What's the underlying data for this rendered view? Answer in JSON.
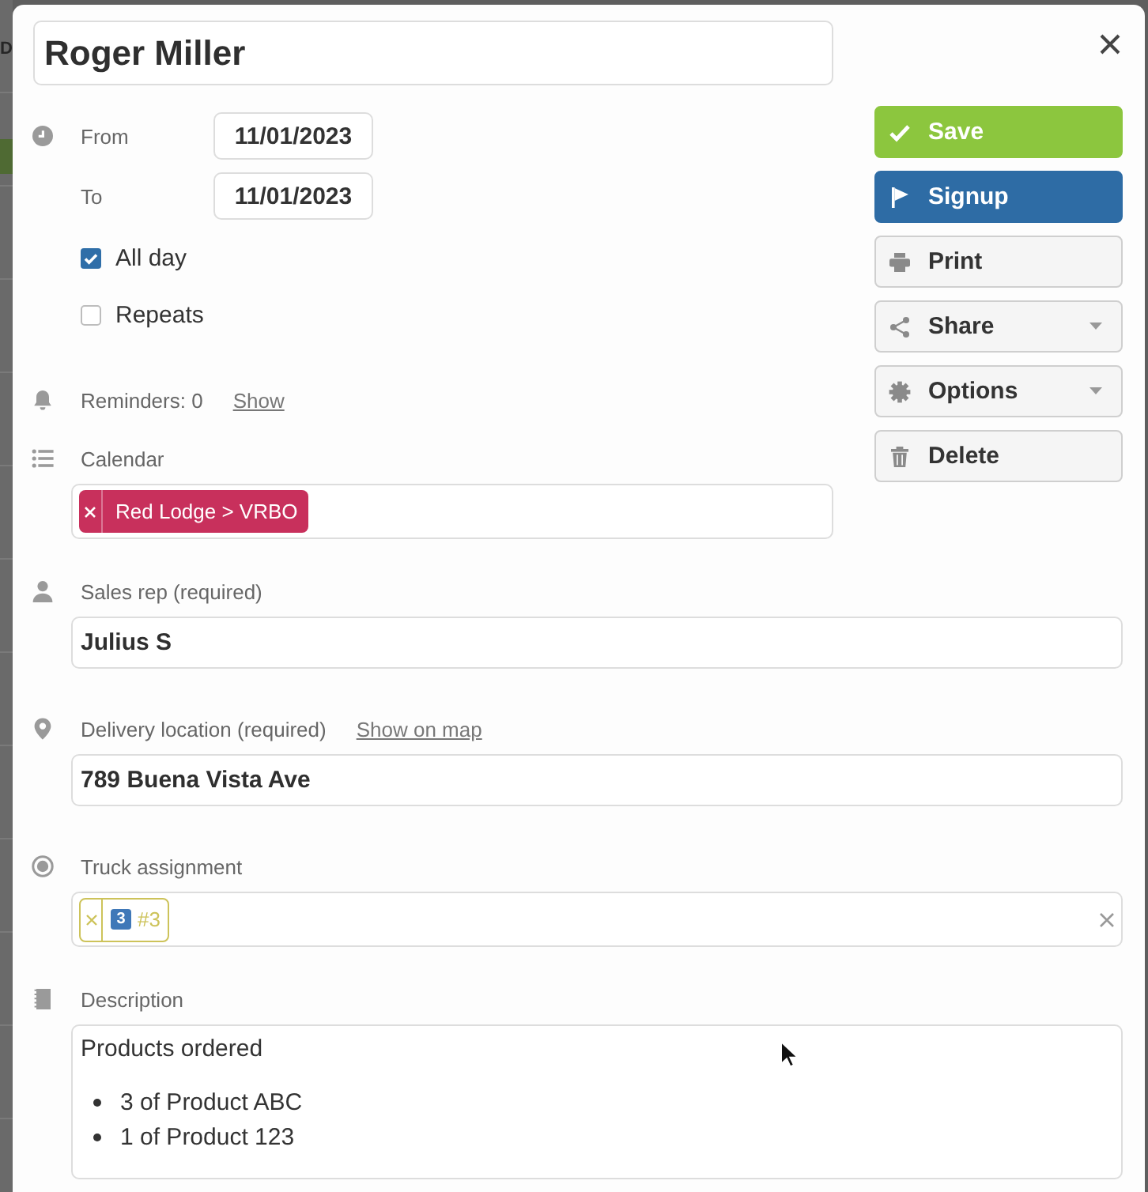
{
  "backdrop": {
    "text": "D"
  },
  "title": {
    "value": "Roger Miller"
  },
  "dates": [
    {
      "label": "From",
      "value": "11/01/2023"
    },
    {
      "label": "To",
      "value": "11/01/2023"
    }
  ],
  "options": [
    {
      "label": "All day",
      "checked": true
    },
    {
      "label": "Repeats",
      "checked": false
    }
  ],
  "reminders": {
    "text": "Reminders: 0",
    "link": "Show"
  },
  "calendar": {
    "label": "Calendar",
    "tags": [
      {
        "text": "Red Lodge > VRBO",
        "color": "#c8305c"
      }
    ]
  },
  "actions": [
    {
      "label": "Save",
      "kind": "success",
      "menu": false
    },
    {
      "label": "Signup",
      "kind": "primary",
      "menu": false
    },
    {
      "label": "Print",
      "kind": "default",
      "menu": false
    },
    {
      "label": "Share",
      "kind": "default",
      "menu": true
    },
    {
      "label": "Options",
      "kind": "default",
      "menu": true
    },
    {
      "label": "Delete",
      "kind": "default",
      "menu": false
    }
  ],
  "fields": [
    {
      "kind": "text",
      "label": "Sales rep (required)",
      "value": "Julius S"
    },
    {
      "kind": "text",
      "label": "Delivery location (required)",
      "link": "Show on map",
      "value": "789 Buena Vista Ave"
    },
    {
      "kind": "tags",
      "label": "Truck assignment",
      "tags": [
        {
          "badge": "3",
          "text": "#3",
          "color": "#cdc35a"
        }
      ]
    },
    {
      "kind": "rich",
      "label": "Description",
      "heading": "Products ordered",
      "items": [
        "3 of Product ABC",
        "1 of Product 123"
      ]
    }
  ]
}
